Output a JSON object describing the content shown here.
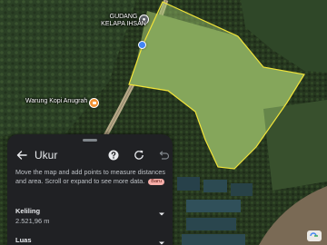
{
  "map": {
    "pois": {
      "gudang": "GUDANG\nKELAPA IHSAN",
      "gudang_line1": "GUDANG",
      "gudang_line2": "KELAPA IHSAN",
      "warung": "Warung Kopi Anugrah"
    },
    "polygon_color": "#f1e43a",
    "polygon_fill": "rgba(160, 200, 110, 0.45)",
    "icons": [
      "warehouse-pin-icon",
      "cafe-pin-icon",
      "location-dot-icon",
      "google-logo-icon"
    ]
  },
  "sheet": {
    "title": "Ukur",
    "description": "Move the map and add points to measure distances and area. Scroll or expand to see more data.",
    "new_badge": "Baru",
    "icons": [
      "back-arrow-icon",
      "help-icon",
      "refresh-icon",
      "undo-icon"
    ],
    "metrics": [
      {
        "label": "Keliling",
        "value": "2.521,96 m"
      },
      {
        "label": "Luas",
        "value": ""
      }
    ]
  },
  "colors": {
    "sheet_background": "#202124",
    "badge_background": "#f6aea9",
    "location_dot": "#4285f4",
    "cafe_pin": "#f29233"
  }
}
